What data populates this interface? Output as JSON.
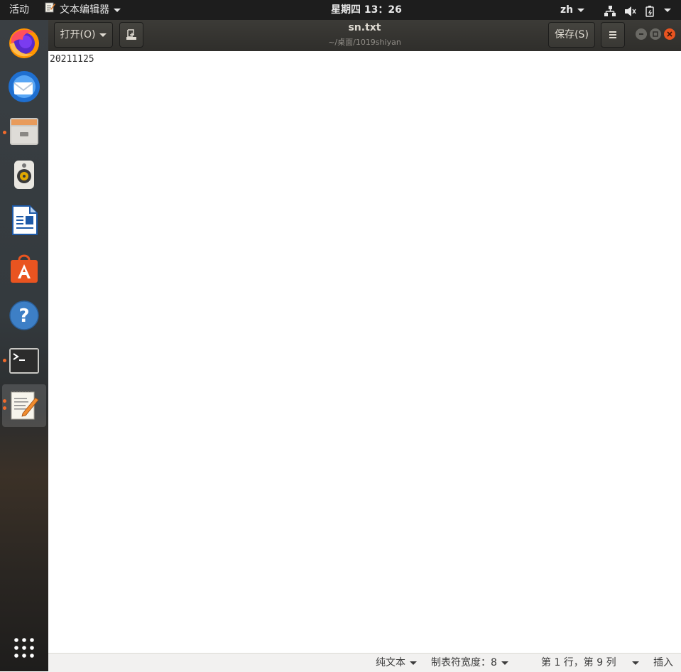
{
  "topbar": {
    "activities": "活动",
    "app_menu": "文本编辑器",
    "clock": "星期四 13：26",
    "input_method": "zh"
  },
  "headerbar": {
    "open_label": "打开(O)",
    "title": "sn.txt",
    "subtitle": "~/桌面/1019shiyan",
    "save_label": "保存(S)"
  },
  "editor": {
    "content": "20211125"
  },
  "statusbar": {
    "language": "纯文本",
    "tab_width": "制表符宽度：8",
    "position": "第 1 行，第 9 列",
    "mode": "插入"
  },
  "dock": {
    "apps": [
      {
        "name": "firefox-icon",
        "running": false
      },
      {
        "name": "thunderbird-icon",
        "running": false
      },
      {
        "name": "files-icon",
        "running": true
      },
      {
        "name": "rhythmbox-icon",
        "running": false
      },
      {
        "name": "libreoffice-writer-icon",
        "running": false
      },
      {
        "name": "software-center-icon",
        "running": false
      },
      {
        "name": "help-icon",
        "running": false
      },
      {
        "name": "terminal-icon",
        "running": true
      },
      {
        "name": "text-editor-icon",
        "running": true
      }
    ]
  },
  "colors": {
    "running_indicator": "#f06a2c",
    "close_button": "#e95420",
    "topbar": "#1d1d1d"
  }
}
